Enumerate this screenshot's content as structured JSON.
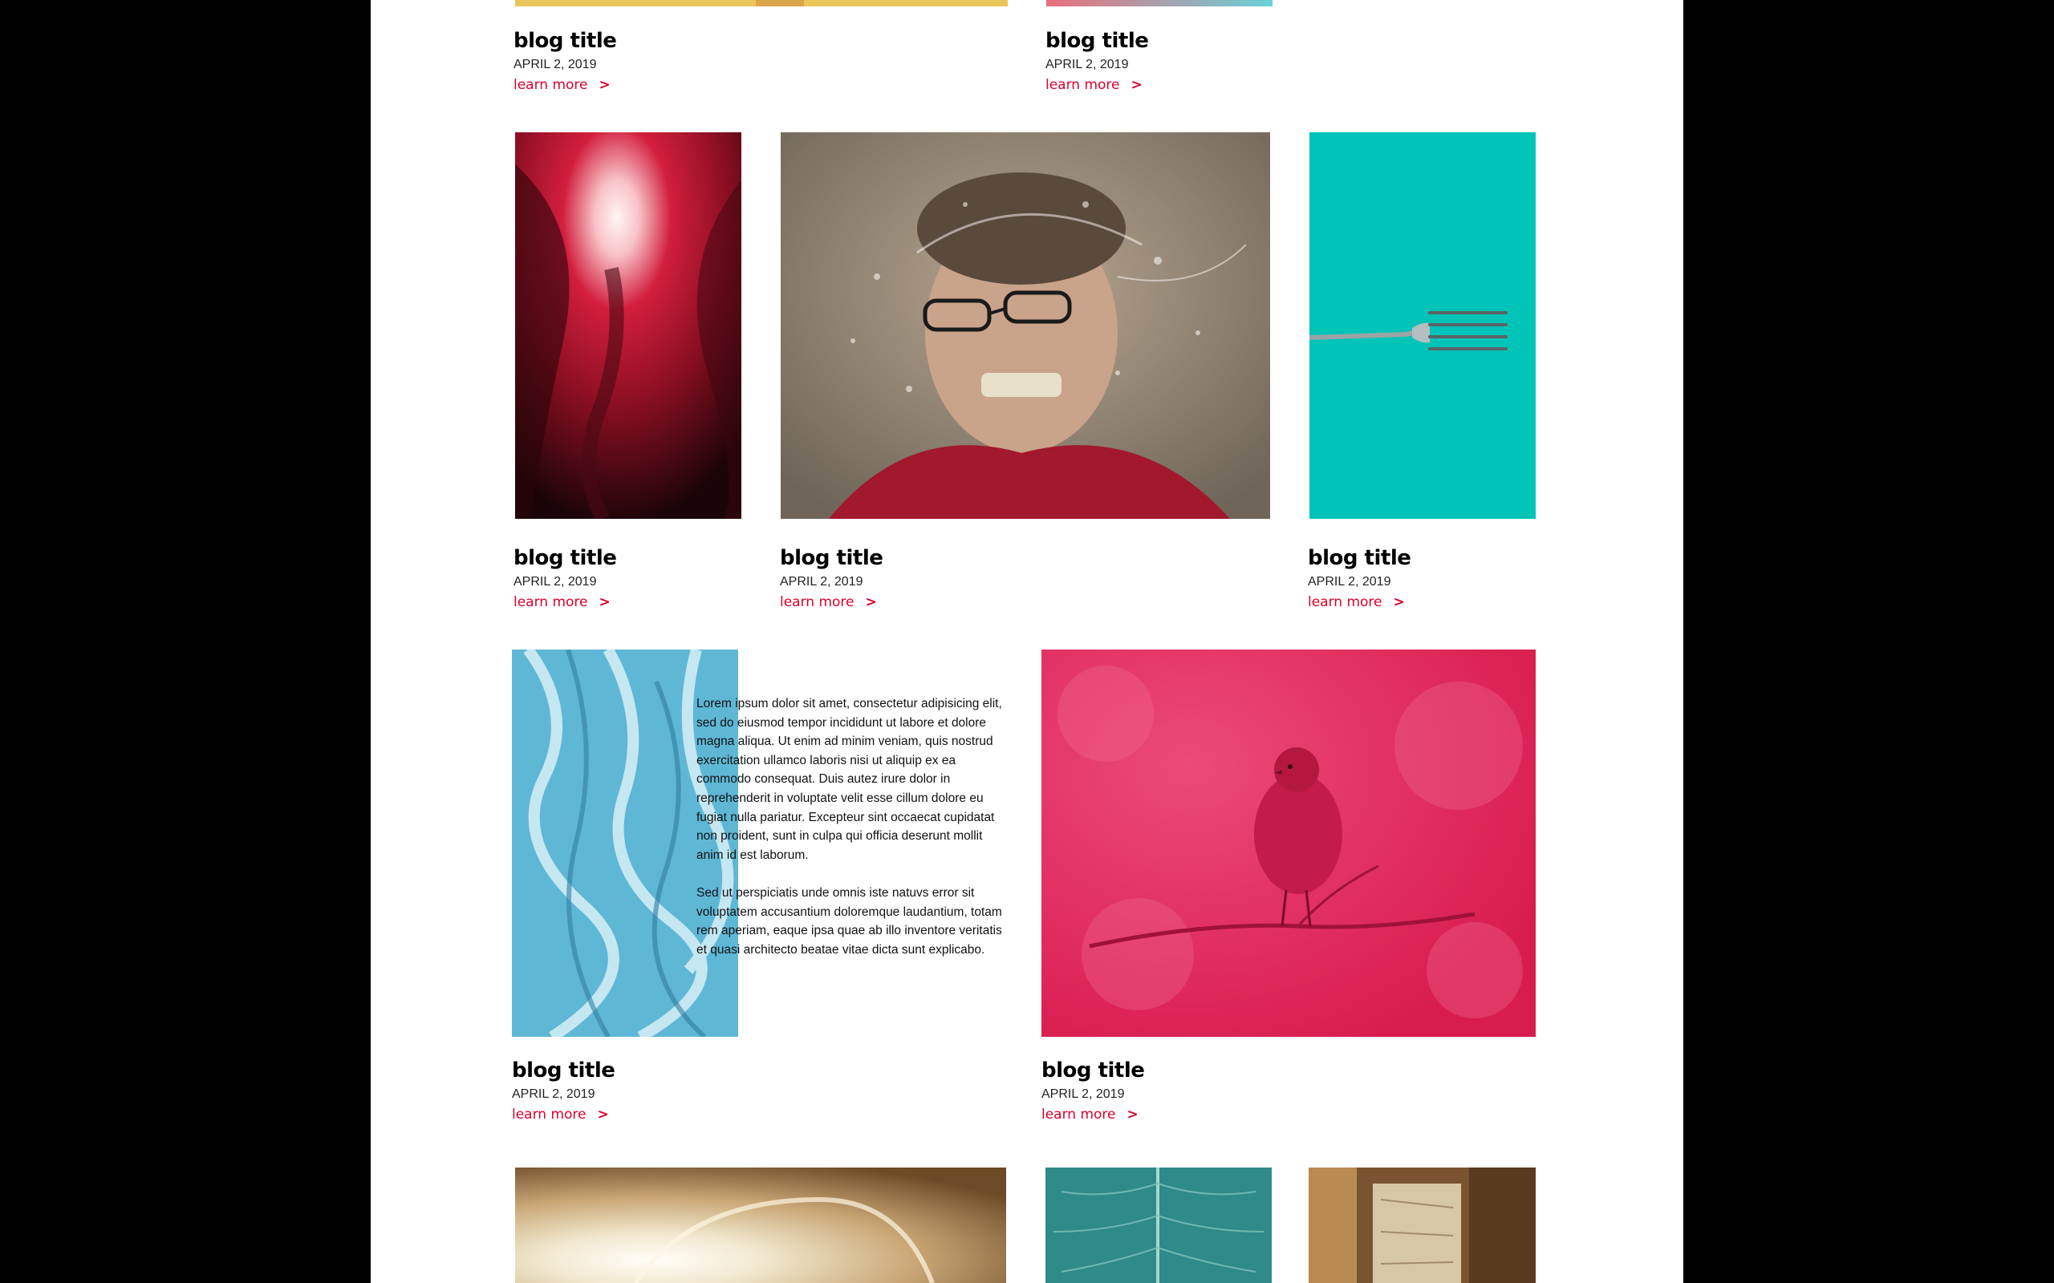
{
  "posts": [
    {
      "title": "blog title",
      "date": "APRIL 2, 2019",
      "more": "learn more",
      "arrow": ">"
    },
    {
      "title": "blog title",
      "date": "APRIL 2, 2019",
      "more": "learn more",
      "arrow": ">"
    },
    {
      "title": "blog title",
      "date": "APRIL 2, 2019",
      "more": "learn more",
      "arrow": ">"
    },
    {
      "title": "blog title",
      "date": "APRIL 2, 2019",
      "more": "learn more",
      "arrow": ">"
    },
    {
      "title": "blog title",
      "date": "APRIL 2, 2019",
      "more": "learn more",
      "arrow": ">"
    },
    {
      "title": "blog title",
      "date": "APRIL 2, 2019",
      "more": "learn more",
      "arrow": ">"
    },
    {
      "title": "blog title",
      "date": "APRIL 2, 2019",
      "more": "learn more",
      "arrow": ">"
    }
  ],
  "featured_text": {
    "paragraph1": "Lorem ipsum dolor sit amet, consectetur adipisicing elit, sed do eiusmod tempor incididunt ut labore et dolore magna aliqua. Ut enim ad minim veniam, quis nostrud exercitation ullamco laboris nisi ut aliquip ex ea commodo consequat. Duis autez irure dolor in reprehenderit in voluptate velit esse cillum dolore eu fugiat nulla pariatur. Excepteur sint occaecat cupidatat non proident, sunt in culpa qui officia deserunt mollit anim id est laborum.",
    "paragraph2": "Sed ut perspiciatis unde omnis iste natuvs error sit voluptatem accusantium doloremque laudantium, totam rem aperiam, eaque ipsa quae ab illo inventore veritatis et quasi architecto beatae vitae dicta sunt explicabo."
  },
  "colors": {
    "page_background": "#ffffff",
    "side_background": "#000000",
    "accent": "#d9022c",
    "turquoise": "#00c4b8",
    "bird_pink": "#e4265a"
  }
}
